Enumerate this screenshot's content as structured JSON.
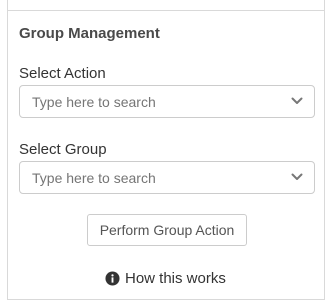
{
  "panel": {
    "title": "Group Management"
  },
  "select_action": {
    "label": "Select Action",
    "placeholder": "Type here to search"
  },
  "select_group": {
    "label": "Select Group",
    "placeholder": "Type here to search"
  },
  "buttons": {
    "perform_label": "Perform Group Action"
  },
  "help": {
    "link_text": "How this works"
  },
  "icons": {
    "dropdown": "chevron-down-icon",
    "help": "info-circle-icon"
  },
  "colors": {
    "border": "#cccccc",
    "panel_border": "#d9d9d9",
    "placeholder": "#757575",
    "text": "#333333"
  }
}
